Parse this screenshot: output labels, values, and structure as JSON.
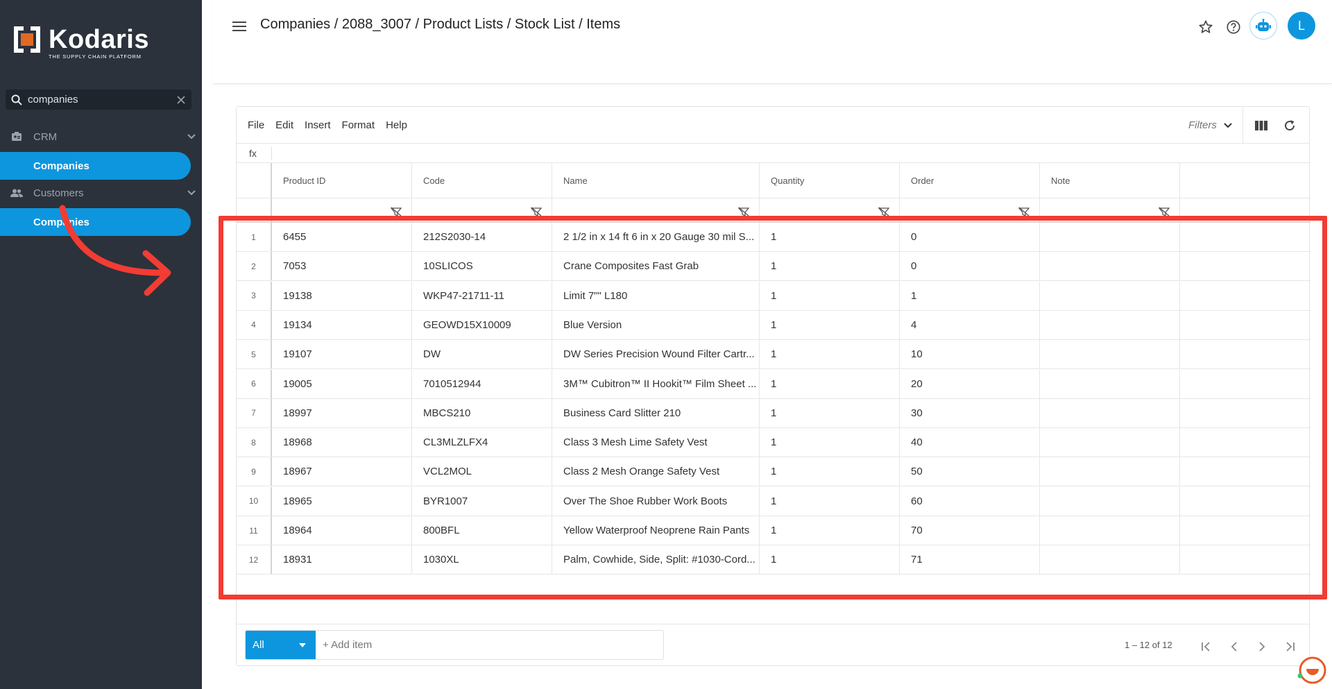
{
  "brand": {
    "name": "Kodaris",
    "tagline": "THE SUPPLY CHAIN PLATFORM"
  },
  "sidebar": {
    "search_value": "companies",
    "groups": [
      {
        "label": "CRM",
        "item": "Companies"
      },
      {
        "label": "Customers",
        "item": "Companies"
      }
    ]
  },
  "header": {
    "breadcrumb": "Companies / 2088_3007 / Product Lists / Stock List / Items",
    "avatar_initial": "L"
  },
  "toolbar": {
    "menus": [
      "File",
      "Edit",
      "Insert",
      "Format",
      "Help"
    ],
    "filters_label": "Filters",
    "fx_label": "fx"
  },
  "grid": {
    "columns": [
      "Product ID",
      "Code",
      "Name",
      "Quantity",
      "Order",
      "Note"
    ],
    "rows": [
      {
        "n": "1",
        "product_id": "6455",
        "code": "212S2030-14",
        "name": "2 1/2 in x 14 ft 6 in x 20 Gauge 30 mil S...",
        "quantity": "1",
        "order": "0",
        "note": ""
      },
      {
        "n": "2",
        "product_id": "7053",
        "code": "10SLICOS",
        "name": "Crane Composites Fast Grab",
        "quantity": "1",
        "order": "0",
        "note": ""
      },
      {
        "n": "3",
        "product_id": "19138",
        "code": "WKP47-21711-11",
        "name": "Limit 7\"\" L180",
        "quantity": "1",
        "order": "1",
        "note": ""
      },
      {
        "n": "4",
        "product_id": "19134",
        "code": "GEOWD15X10009",
        "name": "Blue Version",
        "quantity": "1",
        "order": "4",
        "note": ""
      },
      {
        "n": "5",
        "product_id": "19107",
        "code": "DW",
        "name": "DW Series Precision Wound Filter Cartr...",
        "quantity": "1",
        "order": "10",
        "note": ""
      },
      {
        "n": "6",
        "product_id": "19005",
        "code": "7010512944",
        "name": "3M™ Cubitron™ II Hookit™ Film Sheet ...",
        "quantity": "1",
        "order": "20",
        "note": ""
      },
      {
        "n": "7",
        "product_id": "18997",
        "code": "MBCS210",
        "name": "Business Card Slitter 210",
        "quantity": "1",
        "order": "30",
        "note": ""
      },
      {
        "n": "8",
        "product_id": "18968",
        "code": "CL3MLZLFX4",
        "name": "Class 3 Mesh Lime Safety Vest",
        "quantity": "1",
        "order": "40",
        "note": ""
      },
      {
        "n": "9",
        "product_id": "18967",
        "code": "VCL2MOL",
        "name": "Class 2 Mesh Orange Safety Vest",
        "quantity": "1",
        "order": "50",
        "note": ""
      },
      {
        "n": "10",
        "product_id": "18965",
        "code": "BYR1007",
        "name": "Over The Shoe Rubber Work Boots",
        "quantity": "1",
        "order": "60",
        "note": ""
      },
      {
        "n": "11",
        "product_id": "18964",
        "code": "800BFL",
        "name": "Yellow Waterproof Neoprene Rain Pants",
        "quantity": "1",
        "order": "70",
        "note": ""
      },
      {
        "n": "12",
        "product_id": "18931",
        "code": "1030XL",
        "name": "Palm, Cowhide, Side, Split: #1030-Cord...",
        "quantity": "1",
        "order": "71",
        "note": ""
      }
    ]
  },
  "footer": {
    "select_value": "All",
    "add_placeholder": "+ Add item",
    "pagination": "1 – 12 of 12"
  },
  "colors": {
    "accent": "#0d96de",
    "sidebar_bg": "#2b323b",
    "highlight": "#f23c34"
  }
}
